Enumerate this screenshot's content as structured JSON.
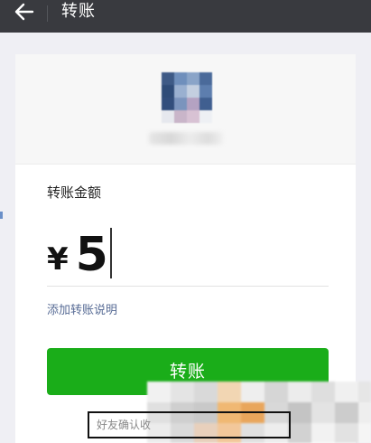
{
  "header": {
    "title": "转账",
    "back_icon": "arrow-left-icon"
  },
  "amount": {
    "label": "转账金额",
    "currency_symbol": "¥",
    "value": "5"
  },
  "note_link": "添加转账说明",
  "transfer_button": "转账",
  "hint_text": "好友确认收",
  "colors": {
    "header_bg": "#393a3f",
    "button_green": "#1aad19",
    "link_blue": "#576b95"
  }
}
